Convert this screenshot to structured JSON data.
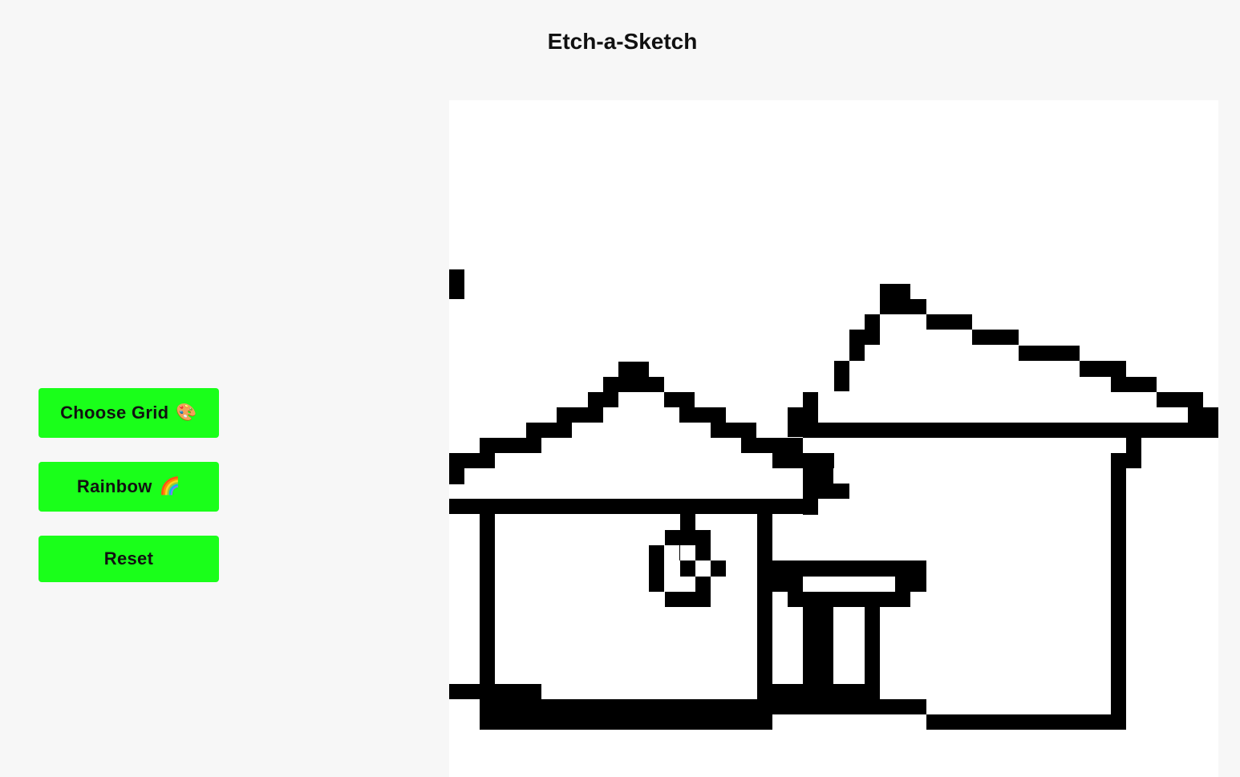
{
  "app": {
    "title": "Etch-a-Sketch"
  },
  "controls": {
    "choose_grid": {
      "label": "Choose Grid",
      "icon": "palette-icon",
      "emoji": "🎨"
    },
    "rainbow": {
      "label": "Rainbow",
      "icon": "rainbow-icon",
      "emoji": "🌈"
    },
    "reset": {
      "label": "Reset"
    }
  },
  "colors": {
    "background": "#f7f7f7",
    "button": "#1aff1a",
    "canvas": "#ffffff",
    "ink": "#000000"
  }
}
